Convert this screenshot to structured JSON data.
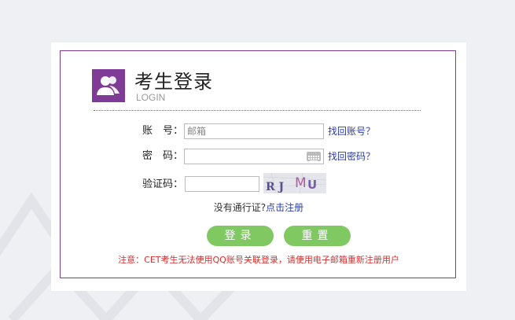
{
  "colors": {
    "brand": "#7e3c97",
    "button": "#7fc862",
    "link": "#2b3da8",
    "notice": "#d62e2e"
  },
  "header": {
    "title": "考生登录",
    "subtitle": "LOGIN",
    "logo_icon": "users-icon"
  },
  "form": {
    "account": {
      "label": "账　号：",
      "placeholder": "邮箱",
      "value": "",
      "link": "找回账号？"
    },
    "password": {
      "label": "密　码：",
      "value": "",
      "link": "找回密码？",
      "icon": "keyboard-icon"
    },
    "captcha": {
      "label": "验证码：",
      "value": "",
      "image_text": "RJ MU"
    },
    "register": {
      "prefix": "没有通行证?",
      "link": "点击注册"
    },
    "login_button": "登录",
    "reset_button": "重置",
    "notice": "注意：CET考生无法使用QQ账号关联登录，请使用电子邮箱重新注册用户"
  }
}
